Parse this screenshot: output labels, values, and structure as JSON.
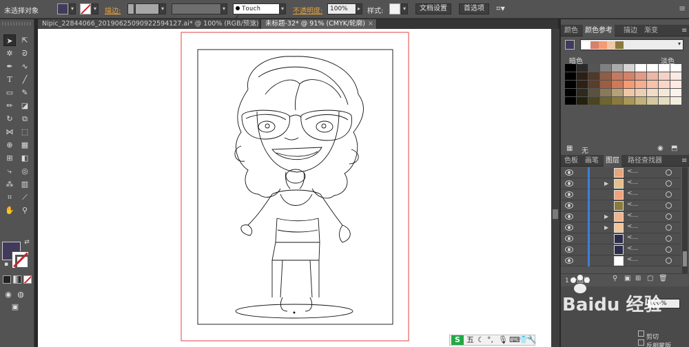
{
  "control_bar": {
    "selection_label": "未选择对象",
    "stroke_label": "描边:",
    "font_field": "Touch C...",
    "opacity_label": "不透明度:",
    "opacity_value": "100%",
    "style_label": "样式:",
    "doc_setup_button": "文档设置",
    "preferences_button": "首选项"
  },
  "tabs": [
    {
      "label": "Nipic_22844066_20190625090922594127.ai* @ 100% (RGB/预览)",
      "active": false
    },
    {
      "label": "未标题-32* @ 91% (CMYK/轮廓)",
      "active": true
    }
  ],
  "color_guide_panel": {
    "tabs": [
      "颜色",
      "颜色参考",
      "描边",
      "渐变"
    ],
    "active_tab": "颜色参考",
    "dark_label": "暗色",
    "light_label": "淡色",
    "none_label": "无",
    "harmony_colors": [
      "#ffffff",
      "#d4826a",
      "#f59a72",
      "#efc6a6",
      "#8a7a3e"
    ],
    "grid_rows": [
      [
        "#000000",
        "#2a2a2a",
        "#555555",
        "#808080",
        "#aaaaaa",
        "#d4d4d4",
        "#ffffff",
        "#ffffff",
        "#ffffff",
        "#ffffff"
      ],
      [
        "#000000",
        "#2b2016",
        "#4d3a2b",
        "#8e5e48",
        "#c17b62",
        "#d4826a",
        "#e09b86",
        "#ebb8a8",
        "#f3d2c8",
        "#faeae4"
      ],
      [
        "#000000",
        "#2d2116",
        "#5a3d2b",
        "#9c5e42",
        "#d27856",
        "#f59a72",
        "#f6ae8e",
        "#f8c2aa",
        "#fad6c6",
        "#fdebe2"
      ],
      [
        "#000000",
        "#2e2a20",
        "#5a5140",
        "#8a7a5a",
        "#b5a07a",
        "#efc6a6",
        "#ecd0b4",
        "#f1dcc6",
        "#f6e8d9",
        "#faf3ec"
      ],
      [
        "#000000",
        "#24220f",
        "#4a4420",
        "#6e6530",
        "#8a7a3e",
        "#a99958",
        "#c1b27a",
        "#d4c89d",
        "#e5dcbf",
        "#f3eedf"
      ]
    ]
  },
  "layers_panel": {
    "tabs": [
      "色板",
      "画笔",
      "图层",
      "路径查找器"
    ],
    "active_tab": "图层",
    "rows": [
      {
        "name": "<...",
        "expand": false,
        "thumb": "#e8a57a"
      },
      {
        "name": "<...",
        "expand": true,
        "thumb": "#e6c08a"
      },
      {
        "name": "<...",
        "expand": false,
        "thumb": "#f1a27a"
      },
      {
        "name": "<...",
        "expand": false,
        "thumb": "#8a7a3e"
      },
      {
        "name": "<...",
        "expand": true,
        "thumb": "#f2b48a"
      },
      {
        "name": "<...",
        "expand": true,
        "thumb": "#f3c59a"
      },
      {
        "name": "<...",
        "expand": false,
        "thumb": "#2b2d4a"
      },
      {
        "name": "<...",
        "expand": false,
        "thumb": "#2b2d4a"
      },
      {
        "name": "<...",
        "expand": false,
        "thumb": "#ffffff"
      }
    ],
    "footer": "1 个图层"
  },
  "bottom": {
    "opacity_value": "100%",
    "cut_label": "剪切",
    "clip_label": "反相蒙版"
  },
  "ime": {
    "logo": "S",
    "mode": "五"
  },
  "watermark": {
    "text": "Baidu 经验"
  },
  "colors": {
    "fill": "#423a5c",
    "artboard_border": "#e04040",
    "layer_highlight": "#3f7fd6"
  }
}
